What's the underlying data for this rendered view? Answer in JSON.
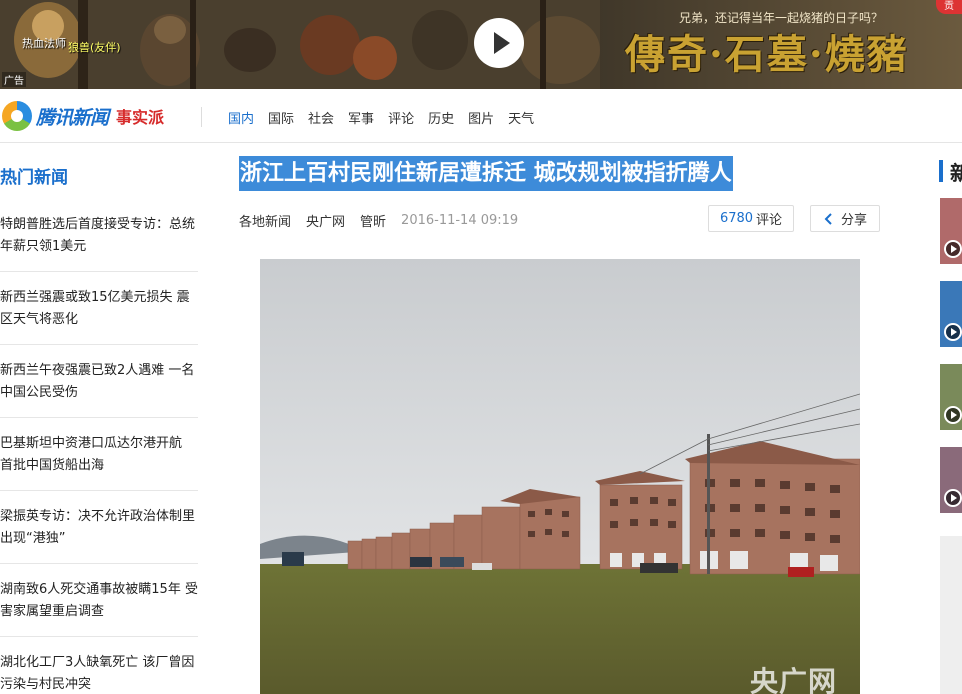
{
  "banner": {
    "subtitle": "兄弟，还记得当年一起烧猪的日子吗？",
    "title": "傳奇·石墓·燒豬",
    "game_label_a": "热血法师",
    "game_label_b": "狼兽(友伴)",
    "ad_label": "广告",
    "close_label": "贡"
  },
  "header": {
    "logo_text": "腾讯新闻",
    "logo_sub": "事实派",
    "nav": [
      {
        "label": "国内",
        "active": true
      },
      {
        "label": "国际",
        "active": false
      },
      {
        "label": "社会",
        "active": false
      },
      {
        "label": "军事",
        "active": false
      },
      {
        "label": "评论",
        "active": false
      },
      {
        "label": "历史",
        "active": false
      },
      {
        "label": "图片",
        "active": false
      },
      {
        "label": "天气",
        "active": false
      }
    ]
  },
  "sidebar": {
    "title": "热门新闻",
    "items": [
      "特朗普胜选后首度接受专访：总统年薪只领1美元",
      "新西兰强震或致15亿美元损失 震区天气将恶化",
      "新西兰午夜强震已致2人遇难 一名中国公民受伤",
      "巴基斯坦中资港口瓜达尔港开航 首批中国货船出海",
      "梁振英专访：决不允许政治体制里出现“港独”",
      "湖南致6人死交通事故被瞒15年 受害家属望重启调查",
      "湖北化工厂3人缺氧死亡 该厂曾因污染与村民冲突"
    ]
  },
  "article": {
    "title": "浙江上百村民刚住新居遭拆迁 城改规划被指折腾人",
    "category": "各地新闻",
    "source": "央广网",
    "author": "管昕",
    "time": "2016-11-14 09:19",
    "comment_count": "6780",
    "comment_label": "评论",
    "share_label": "分享",
    "watermark": "央广网"
  },
  "right_rail": {
    "title": "新"
  },
  "colors": {
    "accent": "#1a6fcc",
    "title_highlight": "#3d8bd9"
  }
}
